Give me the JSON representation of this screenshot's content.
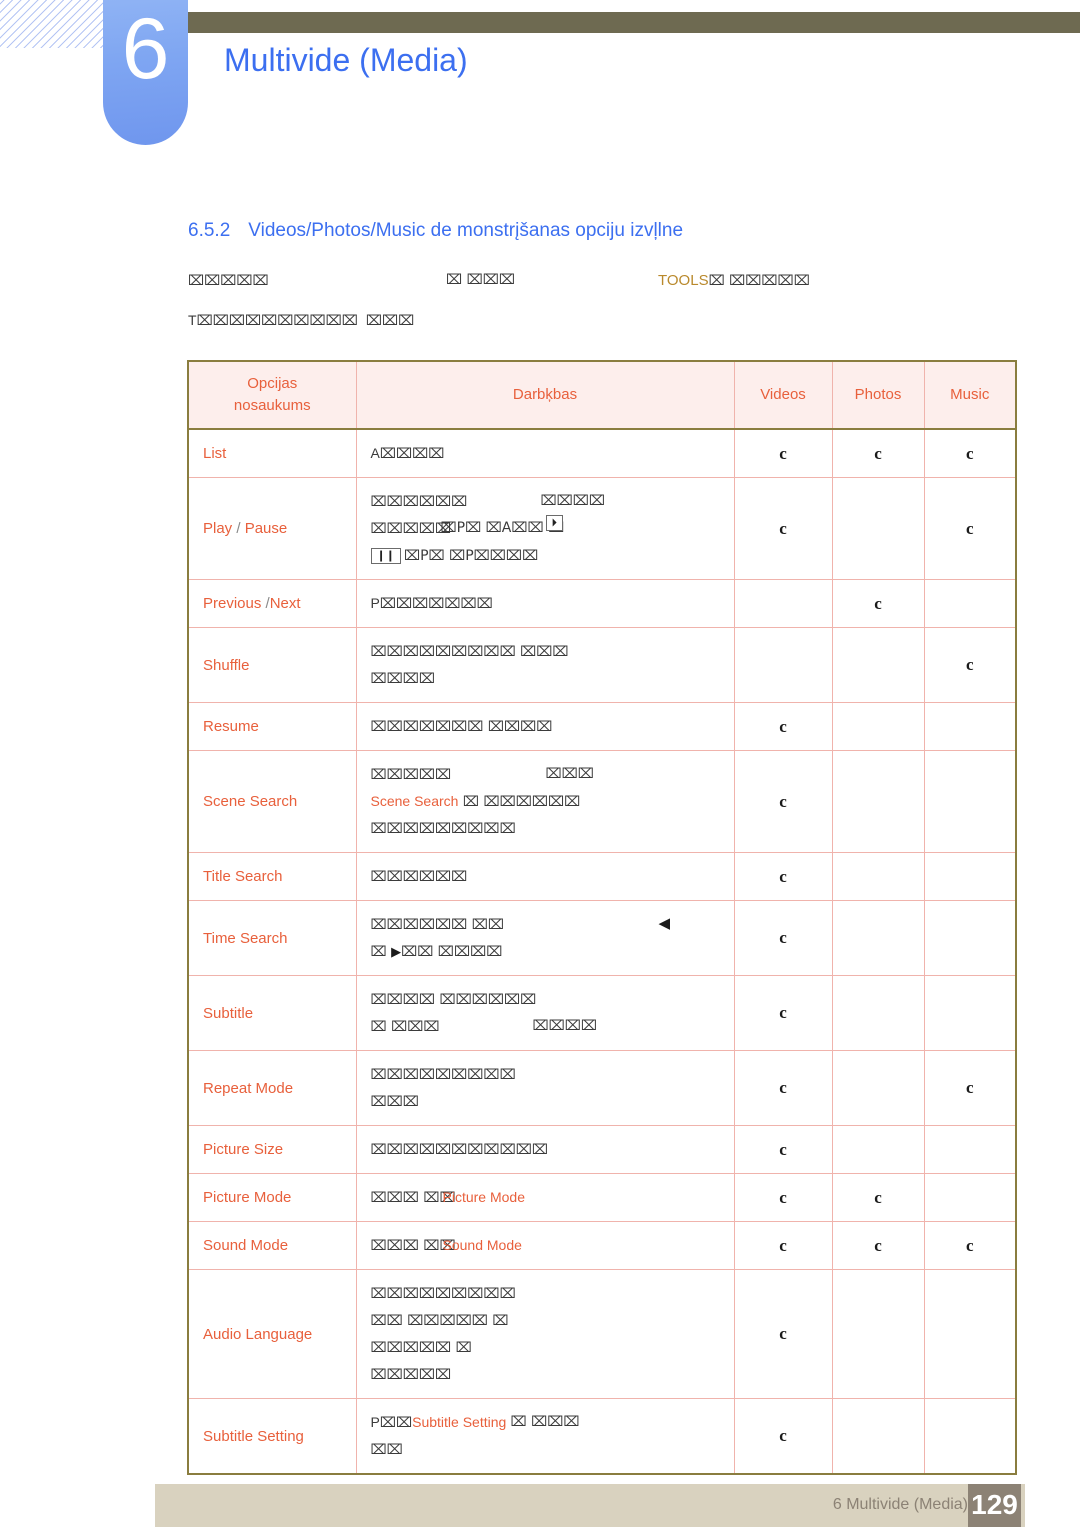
{
  "chapter": {
    "number": "6",
    "title": "Multivide (Media)"
  },
  "section": {
    "number": "6.5.2",
    "title": "Videos/Photos/Music de   monstrįšanas opciju izvļlne"
  },
  "intro": {
    "line1_a": "⌧⌧⌧⌧⌧",
    "line1_b": "⌧ ⌧⌧⌧",
    "line1_tools": "TOOLS",
    "line1_c": "⌧ ⌧⌧⌧⌧⌧",
    "line2_prefix": "T",
    "line2_a": "⌧⌧⌧⌧⌧⌧⌧⌧⌧⌧",
    "line2_b": "⌧⌧⌧"
  },
  "table": {
    "headers": {
      "name_l1": "Opcijas",
      "name_l2": "nosaukums",
      "action": "Darbķbas",
      "videos": "Videos",
      "photos": "Photos",
      "music": "Music"
    },
    "mark": "c",
    "rows": [
      {
        "name": "List",
        "name_parts": null,
        "action_lines": [
          {
            "segments": [
              {
                "t": "A",
                "k": "plain"
              },
              {
                "t": "⌧⌧⌧⌧",
                "k": "tofu"
              }
            ]
          }
        ],
        "videos": "c",
        "photos": "c",
        "music": "c"
      },
      {
        "name": "Play / Pause",
        "name_parts": [
          {
            "t": "Play",
            "k": "kw"
          },
          {
            "t": " / ",
            "k": "slash"
          },
          {
            "t": "Pause",
            "k": "kw"
          }
        ],
        "action_lines": [
          {
            "segments": [
              {
                "t": "⌧⌧⌧⌧⌧⌧",
                "k": "tofu"
              },
              {
                "t": "⌧⌧⌧⌧",
                "k": "tofu",
                "gap": 170
              }
            ]
          },
          {
            "segments": [
              {
                "t": "⌧⌧⌧⌧⌧",
                "k": "tofu"
              },
              {
                "t": "⌧P⌧ ⌧A⌧⌧ ⌧",
                "k": "tofu",
                "gap": 70
              },
              {
                "t": "⏵",
                "k": "key",
                "gap": 175
              }
            ]
          },
          {
            "segments": [
              {
                "t": "❙❙",
                "k": "key"
              },
              {
                "t": "⌧P⌧ ⌧P⌧⌧⌧⌧",
                "k": "tofu"
              }
            ]
          }
        ],
        "videos": "c",
        "photos": "",
        "music": "c"
      },
      {
        "name": "Previous /Next",
        "name_parts": [
          {
            "t": "Previous",
            "k": "kw"
          },
          {
            "t": " /",
            "k": "slash"
          },
          {
            "t": "Next",
            "k": "kw"
          }
        ],
        "action_lines": [
          {
            "segments": [
              {
                "t": "P",
                "k": "plain"
              },
              {
                "t": "⌧⌧⌧⌧⌧⌧⌧",
                "k": "tofu"
              }
            ]
          }
        ],
        "videos": "",
        "photos": "c",
        "music": ""
      },
      {
        "name": "Shuffle",
        "name_parts": null,
        "action_lines": [
          {
            "segments": [
              {
                "t": "⌧⌧⌧⌧⌧⌧⌧⌧⌧ ⌧⌧⌧",
                "k": "tofu"
              }
            ]
          },
          {
            "segments": [
              {
                "t": "⌧⌧⌧⌧",
                "k": "tofu"
              }
            ]
          }
        ],
        "videos": "",
        "photos": "",
        "music": "c"
      },
      {
        "name": "Resume",
        "name_parts": null,
        "action_lines": [
          {
            "segments": [
              {
                "t": "⌧⌧⌧⌧⌧⌧⌧ ⌧⌧⌧⌧",
                "k": "tofu"
              }
            ]
          }
        ],
        "videos": "c",
        "photos": "",
        "music": ""
      },
      {
        "name": "Scene Search",
        "name_parts": null,
        "action_lines": [
          {
            "segments": [
              {
                "t": "⌧⌧⌧⌧⌧",
                "k": "tofu"
              },
              {
                "t": "⌧⌧⌧",
                "k": "tofu",
                "gap": 175
              }
            ]
          },
          {
            "segments": [
              {
                "t": "Scene Search",
                "k": "kw"
              },
              {
                "t": " ⌧ ⌧⌧⌧⌧⌧⌧",
                "k": "tofu"
              }
            ]
          },
          {
            "segments": [
              {
                "t": "⌧⌧⌧⌧⌧⌧⌧⌧⌧",
                "k": "tofu"
              }
            ]
          }
        ],
        "videos": "c",
        "photos": "",
        "music": ""
      },
      {
        "name": "Title Search",
        "name_parts": null,
        "action_lines": [
          {
            "segments": [
              {
                "t": "⌧⌧⌧⌧⌧⌧",
                "k": "tofu"
              }
            ]
          }
        ],
        "videos": "c",
        "photos": "",
        "music": ""
      },
      {
        "name": "Time Search",
        "name_parts": null,
        "action_lines": [
          {
            "segments": [
              {
                "t": "⌧⌧⌧⌧⌧⌧ ⌧⌧",
                "k": "tofu"
              },
              {
                "t": "◀",
                "k": "tri-left",
                "gap": 288
              }
            ]
          },
          {
            "segments": [
              {
                "t": "⌧ ",
                "k": "tofu"
              },
              {
                "t": "▶",
                "k": "tri-right"
              },
              {
                "t": "⌧⌧ ⌧⌧⌧⌧",
                "k": "tofu"
              }
            ]
          }
        ],
        "videos": "c",
        "photos": "",
        "music": ""
      },
      {
        "name": "Subtitle",
        "name_parts": null,
        "action_lines": [
          {
            "segments": [
              {
                "t": "⌧⌧⌧⌧ ⌧⌧⌧⌧⌧⌧",
                "k": "tofu"
              }
            ]
          },
          {
            "segments": [
              {
                "t": "⌧ ⌧⌧⌧",
                "k": "tofu"
              },
              {
                "t": "⌧⌧⌧⌧",
                "k": "tofu",
                "gap": 162
              }
            ]
          }
        ],
        "videos": "c",
        "photos": "",
        "music": ""
      },
      {
        "name": "Repeat Mode",
        "name_parts": null,
        "action_lines": [
          {
            "segments": [
              {
                "t": "⌧⌧⌧⌧⌧⌧⌧⌧⌧",
                "k": "tofu"
              }
            ]
          },
          {
            "segments": [
              {
                "t": "⌧⌧⌧",
                "k": "tofu"
              }
            ]
          }
        ],
        "videos": "c",
        "photos": "",
        "music": "c"
      },
      {
        "name": "Picture Size",
        "name_parts": null,
        "action_lines": [
          {
            "segments": [
              {
                "t": "⌧⌧⌧⌧⌧⌧⌧⌧⌧⌧⌧",
                "k": "tofu"
              }
            ]
          }
        ],
        "videos": "c",
        "photos": "",
        "music": ""
      },
      {
        "name": "Picture Mode",
        "name_parts": null,
        "action_lines": [
          {
            "segments": [
              {
                "t": "⌧⌧⌧",
                "k": "tofu"
              },
              {
                "t": "Picture Mode",
                "k": "kw",
                "gap": 72
              },
              {
                "t": " ⌧⌧",
                "k": "tofu"
              }
            ]
          }
        ],
        "videos": "c",
        "photos": "c",
        "music": ""
      },
      {
        "name": "Sound Mode",
        "name_parts": null,
        "action_lines": [
          {
            "segments": [
              {
                "t": "⌧⌧⌧",
                "k": "tofu"
              },
              {
                "t": "Sound Mode",
                "k": "kw",
                "gap": 72
              },
              {
                "t": " ⌧⌧",
                "k": "tofu"
              }
            ]
          }
        ],
        "videos": "c",
        "photos": "c",
        "music": "c"
      },
      {
        "name": "Audio Language",
        "name_parts": null,
        "action_lines": [
          {
            "segments": [
              {
                "t": "⌧⌧⌧⌧⌧⌧⌧⌧⌧",
                "k": "tofu"
              }
            ]
          },
          {
            "segments": [
              {
                "t": "⌧⌧ ⌧⌧⌧⌧⌧ ⌧",
                "k": "tofu"
              }
            ]
          },
          {
            "segments": [
              {
                "t": "⌧⌧⌧⌧⌧ ⌧",
                "k": "tofu"
              }
            ]
          },
          {
            "segments": [
              {
                "t": "⌧⌧⌧⌧⌧",
                "k": "tofu"
              }
            ]
          }
        ],
        "videos": "c",
        "photos": "",
        "music": ""
      },
      {
        "name": "Subtitle Setting",
        "name_parts": null,
        "action_lines": [
          {
            "segments": [
              {
                "t": "P",
                "k": "plain"
              },
              {
                "t": "⌧⌧",
                "k": "tofu"
              },
              {
                "t": "Subtitle Setting",
                "k": "kw"
              },
              {
                "t": "⌧ ⌧⌧⌧",
                "k": "tofu",
                "gap": 140
              }
            ]
          },
          {
            "segments": [
              {
                "t": "⌧⌧",
                "k": "tofu"
              }
            ]
          }
        ],
        "videos": "c",
        "photos": "",
        "music": ""
      }
    ]
  },
  "footer": {
    "label": "6 Multivide (Media)",
    "page": "129"
  },
  "colors": {
    "accent_blue": "#3c6ff0",
    "badge_blue": "#7fa6f2",
    "olive": "#6e6a51",
    "table_header_bg": "#fdeeec",
    "table_text": "#e8603c",
    "table_border": "#f0b3ac",
    "table_outer_border": "#8a7d3f",
    "tools_gold": "#b9892c",
    "footer_bar": "#d9d2bf",
    "footer_text": "#8c8275"
  }
}
